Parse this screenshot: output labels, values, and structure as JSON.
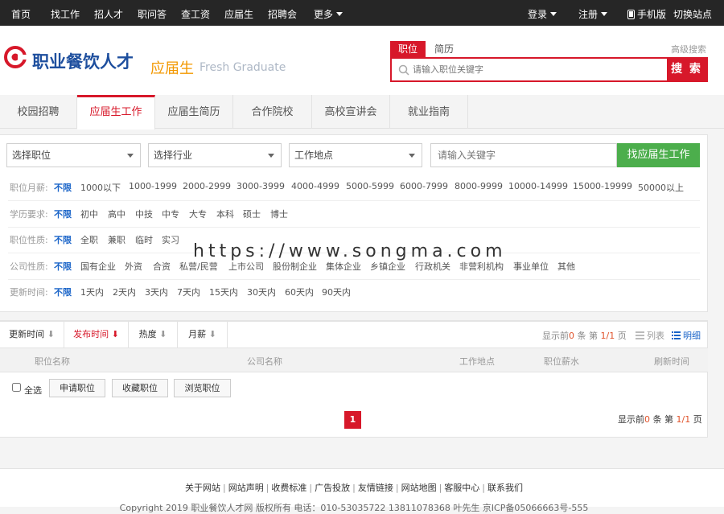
{
  "topnav": {
    "links": [
      "首页",
      "找工作",
      "招人才",
      "职问答",
      "查工资",
      "应届生",
      "招聘会",
      "更多"
    ],
    "login": "登录",
    "register": "注册",
    "mobile": "手机版",
    "switch_site": "切换站点"
  },
  "header": {
    "logo_text": "职业餐饮人才",
    "section_cn": "应届生",
    "section_en": "Fresh Graduate",
    "search_tabs": [
      "职位",
      "简历"
    ],
    "advanced_search": "高级搜索",
    "search_placeholder": "请输入职位关键字",
    "search_button": "搜 索",
    "brand_color": "#d7182a"
  },
  "tabs": [
    "校园招聘",
    "应届生工作",
    "应届生简历",
    "合作院校",
    "高校宣讲会",
    "就业指南"
  ],
  "filters": {
    "select_position": "选择职位",
    "select_industry": "选择行业",
    "select_location": "工作地点",
    "keyword_placeholder": "请输入关键字",
    "search_button": "找应届生工作",
    "rows": [
      {
        "label": "职位月薪:",
        "options": [
          "不限",
          "1000以下",
          "1000-1999",
          "2000-2999",
          "3000-3999",
          "4000-4999",
          "5000-5999",
          "6000-7999",
          "8000-9999",
          "10000-14999",
          "15000-19999",
          "50000以上"
        ]
      },
      {
        "label": "学历要求:",
        "options": [
          "不限",
          "初中",
          "高中",
          "中技",
          "中专",
          "大专",
          "本科",
          "硕士",
          "博士"
        ]
      },
      {
        "label": "职位性质:",
        "options": [
          "不限",
          "全职",
          "兼职",
          "临时",
          "实习"
        ]
      },
      {
        "label": "公司性质:",
        "options": [
          "不限",
          "国有企业",
          "外资",
          "合资",
          "私营/民营",
          "上市公司",
          "股份制企业",
          "集体企业",
          "乡镇企业",
          "行政机关",
          "非营利机构",
          "事业单位",
          "其他"
        ]
      },
      {
        "label": "更新时间:",
        "options": [
          "不限",
          "1天内",
          "2天内",
          "3天内",
          "7天内",
          "15天内",
          "30天内",
          "60天内",
          "90天内"
        ]
      }
    ]
  },
  "watermark": "https://www.songma.com",
  "list": {
    "sorts": [
      "更新时间",
      "发布时间",
      "热度",
      "月薪"
    ],
    "page_info": {
      "prefix": "显示前",
      "count": "0",
      "mid": "条 第",
      "page": "1/1",
      "suffix": "页"
    },
    "view_list": "列表",
    "view_detail": "明细",
    "columns": [
      "职位名称",
      "公司名称",
      "工作地点",
      "职位薪水",
      "刷新时间"
    ],
    "select_all": "全选",
    "actions": [
      "申请职位",
      "收藏职位",
      "浏览职位"
    ],
    "current_page": "1"
  },
  "footer": {
    "links": [
      "关于网站",
      "网站声明",
      "收费标准",
      "广告投放",
      "友情链接",
      "网站地图",
      "客服中心",
      "联系我们"
    ],
    "copyright": "Copyright 2019 职业餐饮人才网 版权所有 电话：010-53035722 13811078368 叶先生 京ICP备05066663号-555"
  }
}
